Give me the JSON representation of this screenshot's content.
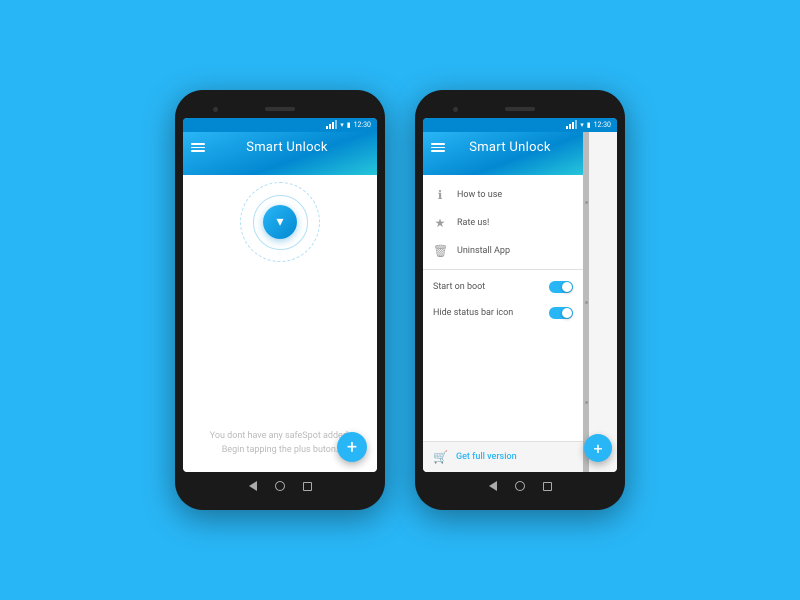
{
  "background_color": "#29b6f6",
  "phone1": {
    "status_bar": {
      "time": "12:30"
    },
    "header": {
      "menu_label": "menu",
      "title": "Smart Unlock"
    },
    "content": {
      "empty_message_line1": "You dont have any safeSpot added.",
      "empty_message_line2": "Begin tapping the plus buton.",
      "fab_label": "+"
    },
    "nav": {
      "back": "back",
      "home": "home",
      "recents": "recents"
    }
  },
  "phone2": {
    "status_bar": {
      "time": "12:30"
    },
    "header": {
      "menu_label": "menu",
      "title": "Smart Unlock"
    },
    "drawer": {
      "items": [
        {
          "icon": "ℹ",
          "label": "How to use"
        },
        {
          "icon": "★",
          "label": "Rate us!"
        },
        {
          "icon": "🗑",
          "label": "Uninstall App"
        }
      ],
      "toggles": [
        {
          "label": "Start on boot",
          "enabled": true
        },
        {
          "label": "Hide status bar icon",
          "enabled": true
        }
      ],
      "footer": {
        "icon": "🛒",
        "label": "Get full version"
      }
    },
    "fab_label": "+",
    "nav": {
      "back": "back",
      "home": "home",
      "recents": "recents"
    }
  }
}
